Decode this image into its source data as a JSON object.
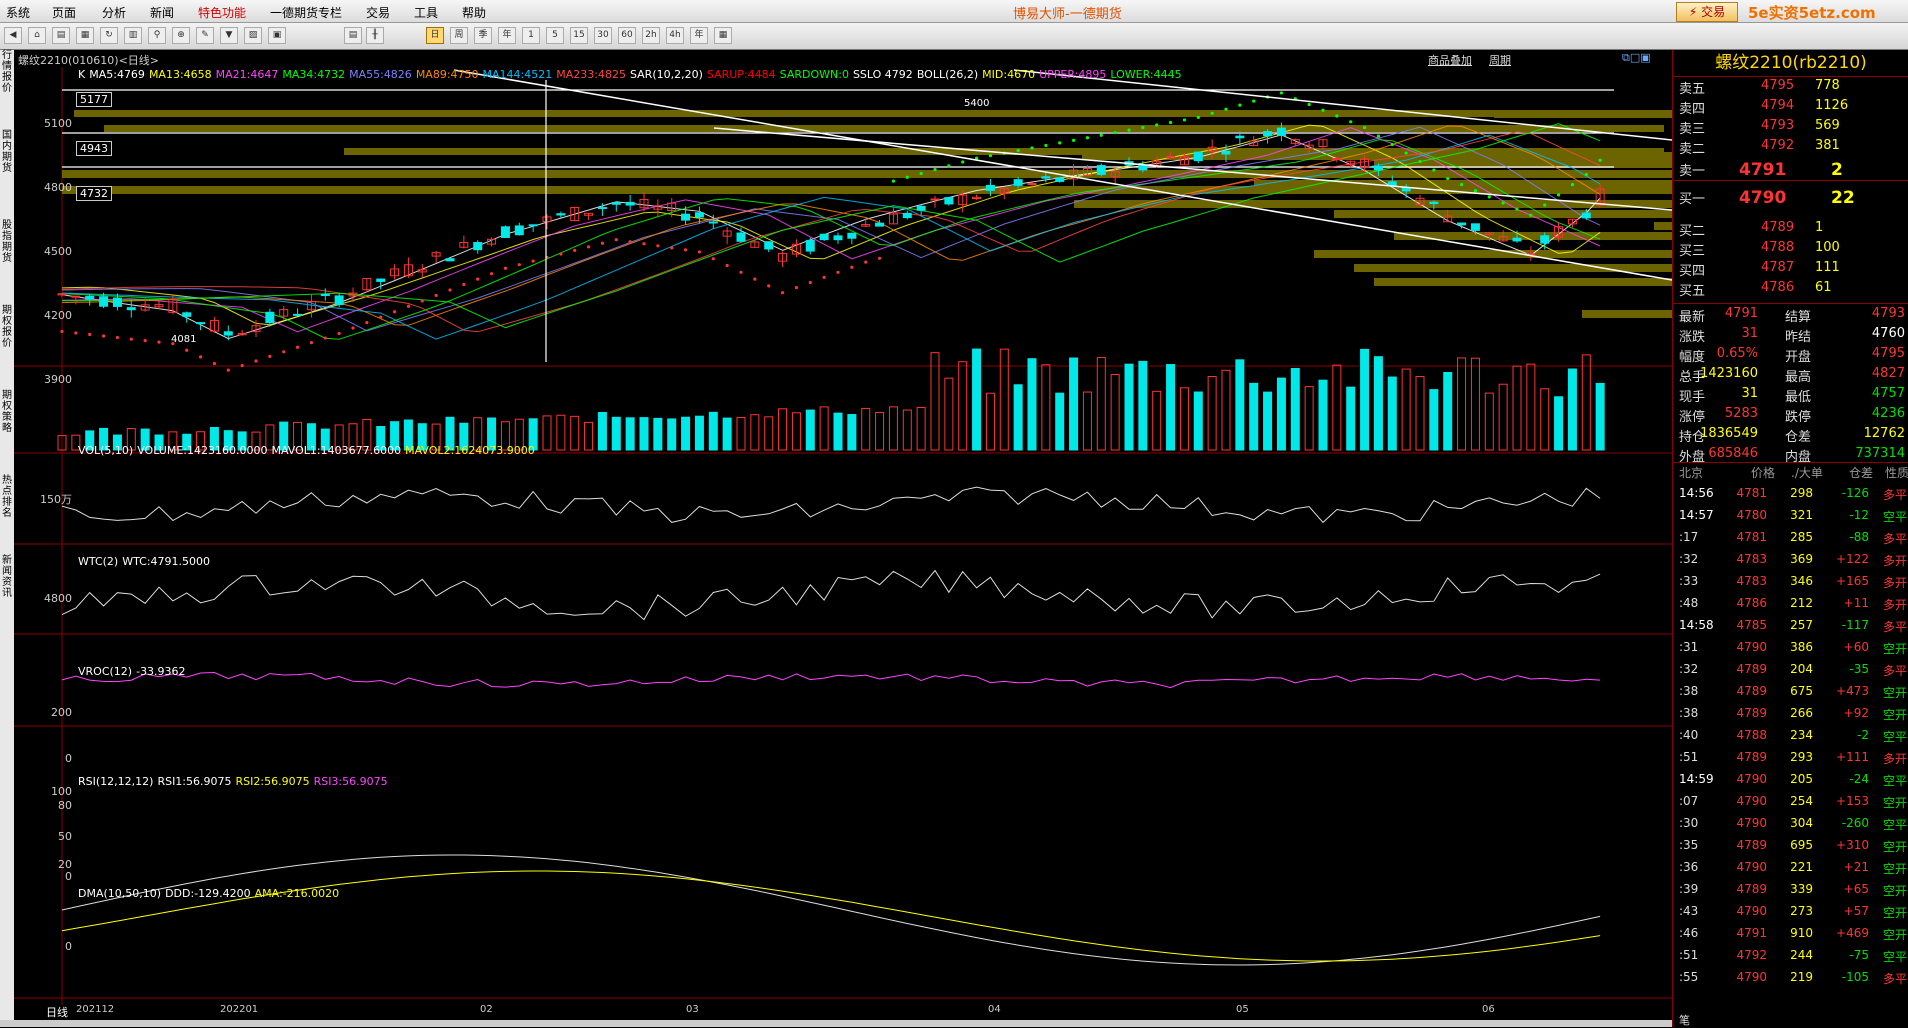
{
  "menu": {
    "items": [
      "系统",
      "页面",
      "分析",
      "新闻",
      "特色功能",
      "一德期货专栏",
      "交易",
      "工具",
      "帮助"
    ],
    "app_title": "博易大师-一德期货",
    "trade_button": "交易",
    "watermark": "5e实资5etz.com"
  },
  "toolbar": {
    "selected_label": "日",
    "period_labels": [
      "日",
      "周",
      "季",
      "年",
      "1",
      "5",
      "15",
      "30",
      "60",
      "2h",
      "4h",
      "年"
    ]
  },
  "left_tabs": [
    "行情报价",
    "国内期货",
    "股指期货",
    "期权报价",
    "期权策略",
    "热点排名",
    "新闻资讯"
  ],
  "chart": {
    "contract_title": "螺纹2210(010610)<日线>",
    "overlay_buttons": [
      "商品叠加",
      "周期"
    ],
    "main_indicators": [
      {
        "text": "K",
        "color": "#ffffff"
      },
      {
        "text": "MA5:4769",
        "color": "#ffffff"
      },
      {
        "text": "MA13:4658",
        "color": "#ffff00"
      },
      {
        "text": "MA21:4647",
        "color": "#ff44ff"
      },
      {
        "text": "MA34:4732",
        "color": "#00ff00"
      },
      {
        "text": "MA55:4826",
        "color": "#8080ff"
      },
      {
        "text": "MA89:4750",
        "color": "#ff8800"
      },
      {
        "text": "MA144:4521",
        "color": "#00c0ff"
      },
      {
        "text": "MA233:4825",
        "color": "#ff4444"
      },
      {
        "text": "SAR(10,2,20)",
        "color": "#ffffff"
      },
      {
        "text": "SARUP:4484",
        "color": "#ff0000"
      },
      {
        "text": "SARDOWN:0",
        "color": "#00ff00"
      },
      {
        "text": "SSLO 4792",
        "color": "#ffffff"
      },
      {
        "text": "BOLL(26,2)",
        "color": "#ffffff"
      },
      {
        "text": "MID:4670",
        "color": "#ffff00"
      },
      {
        "text": "UPPER:4895",
        "color": "#ff44ff"
      },
      {
        "text": "LOWER:4445",
        "color": "#00ff00"
      }
    ],
    "main_y_labels": [
      "5100",
      "4800",
      "4500",
      "4200",
      "3900"
    ],
    "price_boxes": [
      "5177",
      "4943",
      "4732"
    ],
    "peak_label": "5400",
    "low_label": "4081",
    "volume_indicators": [
      {
        "text": "VOL(5,10)",
        "color": "#ffffff"
      },
      {
        "text": "VOLUME:1423160.0000",
        "color": "#ffffff"
      },
      {
        "text": "MAVOL1:1403677.6000",
        "color": "#ffffff"
      },
      {
        "text": "MAVOL2:1624073.9000",
        "color": "#ffff00"
      }
    ],
    "volume_y_label": "150万",
    "wtc_indicators": [
      {
        "text": "WTC(2)",
        "color": "#ffffff"
      },
      {
        "text": "WTC:4791.5000",
        "color": "#ffffff"
      }
    ],
    "wtc_y_label": "4800",
    "vroc_indicators": [
      {
        "text": "VROC(12)",
        "color": "#ffffff"
      },
      {
        "text": "-33.9362",
        "color": "#ffffff"
      }
    ],
    "vroc_y_labels": [
      "200",
      "0"
    ],
    "rsi_indicators": [
      {
        "text": "RSI(12,12,12)",
        "color": "#ffffff"
      },
      {
        "text": "RSI1:56.9075",
        "color": "#ffffff"
      },
      {
        "text": "RSI2:56.9075",
        "color": "#ffff00"
      },
      {
        "text": "RSI3:56.9075",
        "color": "#ff44ff"
      }
    ],
    "rsi_y_labels": [
      "100",
      "80",
      "50",
      "20",
      "0"
    ],
    "dma_indicators": [
      {
        "text": "DMA(10,50,10)",
        "color": "#ffffff"
      },
      {
        "text": "DDD:-129.4200",
        "color": "#ffffff"
      },
      {
        "text": "AMA:-216.0020",
        "color": "#ffff00"
      }
    ],
    "dma_y_label": "0",
    "period_label": "日线",
    "date_labels": [
      "202112",
      "202201",
      "02",
      "03",
      "04",
      "05",
      "06"
    ]
  },
  "quote": {
    "title": "螺纹2210(rb2210)",
    "asks": [
      {
        "label": "卖五",
        "price": "4795",
        "vol": "778"
      },
      {
        "label": "卖四",
        "price": "4794",
        "vol": "1126"
      },
      {
        "label": "卖三",
        "price": "4793",
        "vol": "569"
      },
      {
        "label": "卖二",
        "price": "4792",
        "vol": "381"
      },
      {
        "label": "卖一",
        "price": "4791",
        "vol": "2"
      }
    ],
    "bids": [
      {
        "label": "买一",
        "price": "4790",
        "vol": "22"
      },
      {
        "label": "买二",
        "price": "4789",
        "vol": "1"
      },
      {
        "label": "买三",
        "price": "4788",
        "vol": "100"
      },
      {
        "label": "买四",
        "price": "4787",
        "vol": "111"
      },
      {
        "label": "买五",
        "price": "4786",
        "vol": "61"
      }
    ],
    "stats": [
      {
        "l1": "最新",
        "v1": "4791",
        "l2": "结算",
        "v2": "4793"
      },
      {
        "l1": "涨跌",
        "v1": "31",
        "l2": "昨结",
        "v2": "4760"
      },
      {
        "l1": "幅度",
        "v1": "0.65%",
        "l2": "开盘",
        "v2": "4795"
      },
      {
        "l1": "总手",
        "v1": "1423160",
        "l2": "最高",
        "v2": "4827"
      },
      {
        "l1": "现手",
        "v1": "31",
        "l2": "最低",
        "v2": "4757"
      },
      {
        "l1": "涨停",
        "v1": "5283",
        "l2": "跌停",
        "v2": "4236"
      },
      {
        "l1": "持仓",
        "v1": "1836549",
        "l2": "仓差",
        "v2": "12762"
      },
      {
        "l1": "外盘",
        "v1": "685846",
        "l2": "内盘",
        "v2": "737314"
      }
    ],
    "tick_header": {
      "time": "北京",
      "price": "价格",
      "vol": "./大单",
      "oi": "仓差",
      "nature": "性质"
    },
    "ticks": [
      {
        "t": "14:56",
        "p": "4781",
        "v": "298",
        "oi": "-126",
        "n": "多平"
      },
      {
        "t": "14:57",
        "p": "4780",
        "v": "321",
        "oi": "-12",
        "n": "空平"
      },
      {
        "t": ":17",
        "p": "4781",
        "v": "285",
        "oi": "-88",
        "n": "多平"
      },
      {
        "t": ":32",
        "p": "4783",
        "v": "369",
        "oi": "+122",
        "n": "多开"
      },
      {
        "t": ":33",
        "p": "4783",
        "v": "346",
        "oi": "+165",
        "n": "多开"
      },
      {
        "t": ":48",
        "p": "4786",
        "v": "212",
        "oi": "+11",
        "n": "多开"
      },
      {
        "t": "14:58",
        "p": "4785",
        "v": "257",
        "oi": "-117",
        "n": "多平"
      },
      {
        "t": ":31",
        "p": "4790",
        "v": "386",
        "oi": "+60",
        "n": "空开"
      },
      {
        "t": ":32",
        "p": "4789",
        "v": "204",
        "oi": "-35",
        "n": "多平"
      },
      {
        "t": ":38",
        "p": "4789",
        "v": "675",
        "oi": "+473",
        "n": "空开"
      },
      {
        "t": ":38",
        "p": "4789",
        "v": "266",
        "oi": "+92",
        "n": "空开"
      },
      {
        "t": ":40",
        "p": "4788",
        "v": "234",
        "oi": "-2",
        "n": "空平"
      },
      {
        "t": ":51",
        "p": "4789",
        "v": "293",
        "oi": "+111",
        "n": "多开"
      },
      {
        "t": "14:59",
        "p": "4790",
        "v": "205",
        "oi": "-24",
        "n": "空平"
      },
      {
        "t": ":07",
        "p": "4790",
        "v": "254",
        "oi": "+153",
        "n": "空开"
      },
      {
        "t": ":30",
        "p": "4790",
        "v": "304",
        "oi": "-260",
        "n": "空平"
      },
      {
        "t": ":35",
        "p": "4789",
        "v": "695",
        "oi": "+310",
        "n": "空开"
      },
      {
        "t": ":36",
        "p": "4790",
        "v": "221",
        "oi": "+21",
        "n": "空开"
      },
      {
        "t": ":39",
        "p": "4789",
        "v": "339",
        "oi": "+65",
        "n": "空开"
      },
      {
        "t": ":43",
        "p": "4790",
        "v": "273",
        "oi": "+57",
        "n": "空开"
      },
      {
        "t": ":46",
        "p": "4791",
        "v": "910",
        "oi": "+469",
        "n": "空开"
      },
      {
        "t": ":51",
        "p": "4792",
        "v": "244",
        "oi": "-75",
        "n": "空平"
      },
      {
        "t": ":55",
        "p": "4790",
        "v": "219",
        "oi": "-105",
        "n": "多平"
      }
    ],
    "bottom_tab": "笔"
  },
  "colors": {
    "up": "#ff3333",
    "down": "#00e8e8",
    "grid": "#8a0000",
    "accent": "#ffd800"
  }
}
